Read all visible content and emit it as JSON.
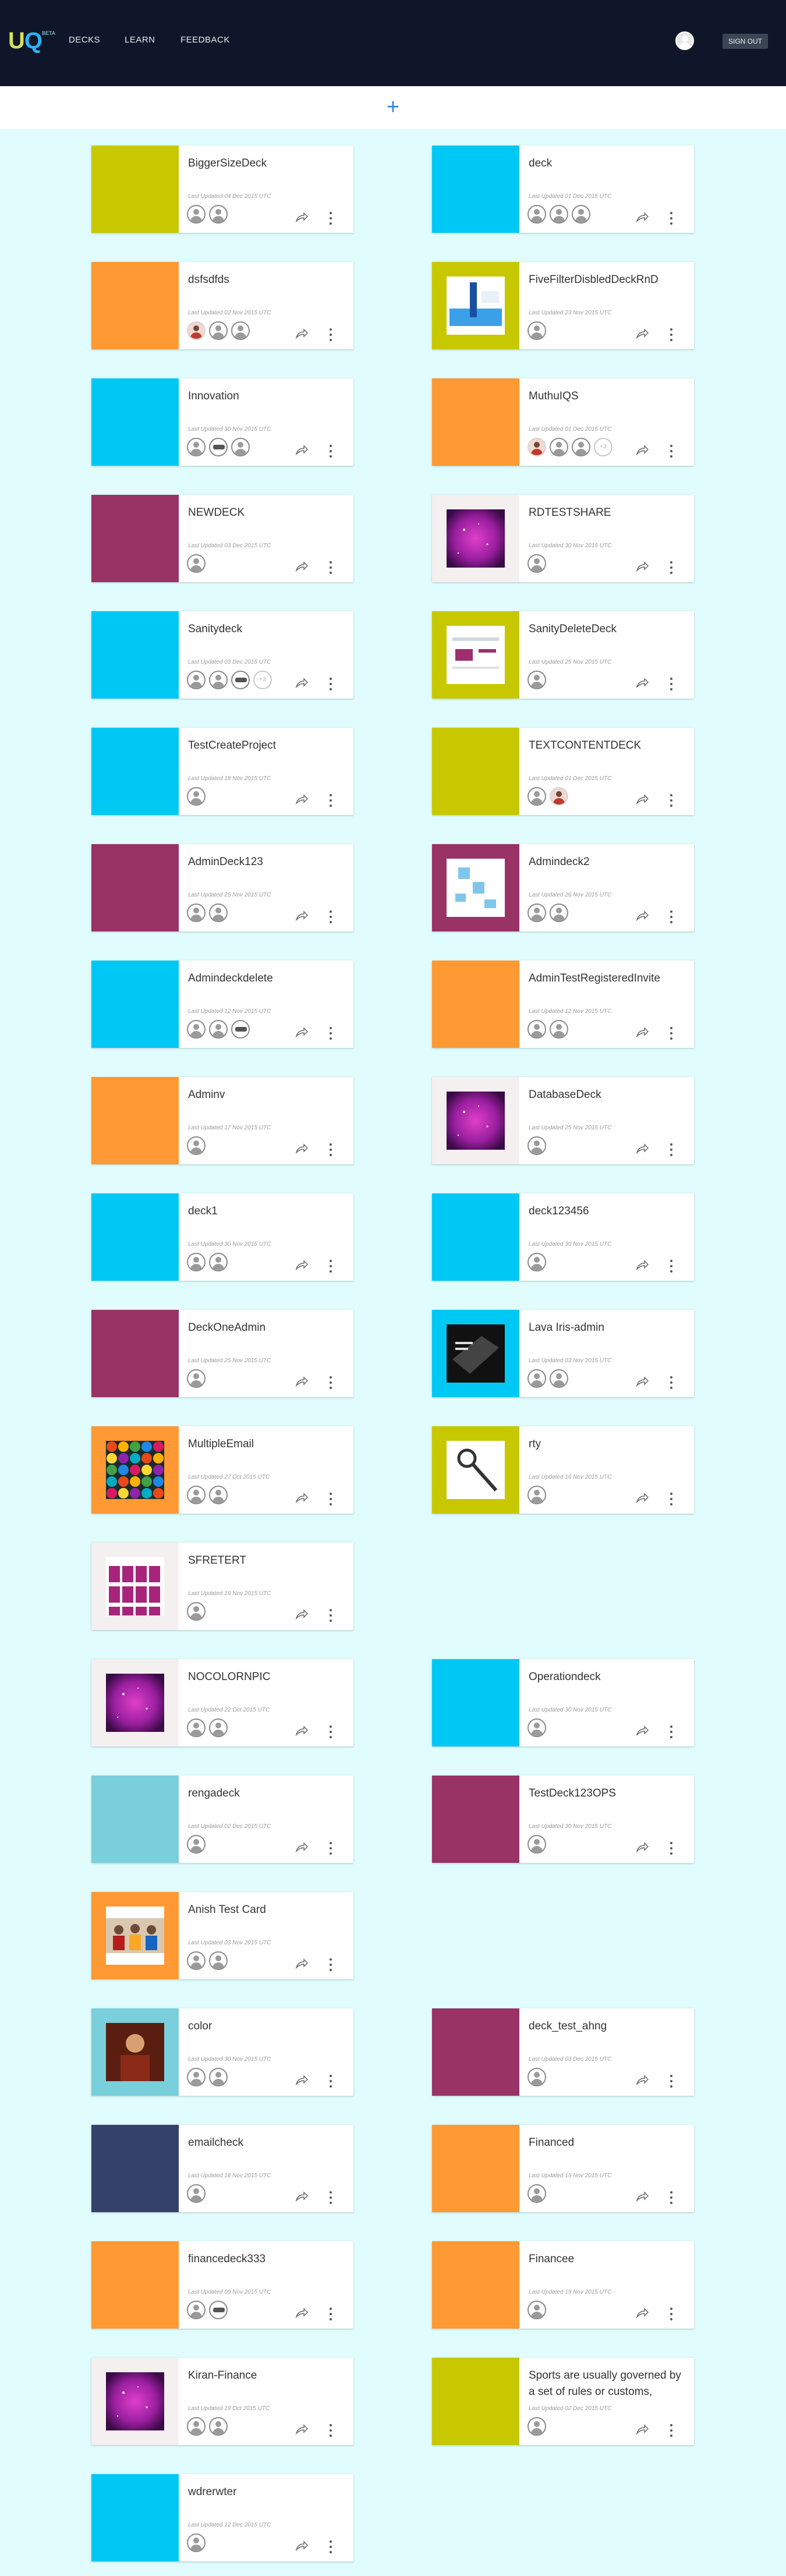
{
  "nav": {
    "logo_u": "U",
    "logo_q": "Q",
    "logo_beta": "BETA",
    "links": [
      "DECKS",
      "LEARN",
      "FEEDBACK"
    ],
    "signout_label": "SIGN OUT"
  },
  "add_button": {
    "label": "+"
  },
  "decks": [
    {
      "title": "BiggerSizeDeck",
      "updated": "Last Updated 04 Dec 2015 UTC",
      "color": "#c8c800",
      "thumb": "",
      "avatars": [
        "p",
        "p"
      ]
    },
    {
      "title": "deck",
      "updated": "Last Updated 01 Dec 2015 UTC",
      "color": "#00c8f5",
      "thumb": "",
      "avatars": [
        "p",
        "p",
        "p"
      ]
    },
    {
      "title": "dsfsdfds",
      "updated": "Last Updated 02 Nov 2015 UTC",
      "color": "#ff9933",
      "thumb": "",
      "avatars": [
        "photo",
        "p",
        "p"
      ]
    },
    {
      "title": "FiveFilterDisbledDeckRnD",
      "updated": "Last Updated 23 Nov 2015 UTC",
      "color": "#c8c800",
      "thumb": "chart",
      "avatars": [
        "p"
      ]
    },
    {
      "title": "Innovation",
      "updated": "Last Updated 30 Nov 2015 UTC",
      "color": "#00c8f5",
      "thumb": "",
      "avatars": [
        "p",
        "logo",
        "p"
      ]
    },
    {
      "title": "MuthuIQS",
      "updated": "Last Updated 01 Dec 2015 UTC",
      "color": "#ff9933",
      "thumb": "",
      "avatars": [
        "photo",
        "p",
        "p",
        "+3"
      ]
    },
    {
      "title": "NEWDECK",
      "updated": "Last Updated 03 Dec 2015 UTC",
      "color": "#993366",
      "thumb": "",
      "avatars": [
        "p"
      ]
    },
    {
      "title": "RDTESTSHARE",
      "updated": "Last Updated 30 Nov 2015 UTC",
      "color": "#f5f0f0",
      "thumb": "galaxy",
      "avatars": [
        "p"
      ]
    },
    {
      "title": "Sanitydeck",
      "updated": "Last Updated 03 Dec 2015 UTC",
      "color": "#00c8f5",
      "thumb": "",
      "avatars": [
        "p",
        "p",
        "logo",
        "+3"
      ]
    },
    {
      "title": "SanityDeleteDeck",
      "updated": "Last Updated 25 Nov 2015 UTC",
      "color": "#c8c800",
      "thumb": "screenshot",
      "avatars": [
        "p"
      ]
    },
    {
      "title": "TestCreateProject",
      "updated": "Last Updated 18 Nov 2015 UTC",
      "color": "#00c8f5",
      "thumb": "",
      "avatars": [
        "p"
      ]
    },
    {
      "title": "TEXTCONTENTDECK",
      "updated": "Last Updated 01 Dec 2015 UTC",
      "color": "#c8c800",
      "thumb": "",
      "avatars": [
        "p",
        "photo"
      ]
    },
    {
      "title": "AdminDeck123",
      "updated": "Last Updated 25 Nov 2015 UTC",
      "color": "#993366",
      "thumb": "",
      "avatars": [
        "p",
        "p"
      ]
    },
    {
      "title": "Admindeck2",
      "updated": "Last Updated 26 Nov 2015 UTC",
      "color": "#993366",
      "thumb": "diagram",
      "avatars": [
        "p",
        "p"
      ]
    },
    {
      "title": "Admindeckdelete",
      "updated": "Last Updated 12 Nov 2015 UTC",
      "color": "#00c8f5",
      "thumb": "",
      "avatars": [
        "p",
        "p",
        "logo"
      ]
    },
    {
      "title": "AdminTestRegisteredInvite",
      "updated": "Last Updated 12 Nov 2015 UTC",
      "color": "#ff9933",
      "thumb": "",
      "avatars": [
        "p",
        "p"
      ]
    },
    {
      "title": "Adminv",
      "updated": "Last Updated 17 Nov 2015 UTC",
      "color": "#ff9933",
      "thumb": "",
      "avatars": [
        "p"
      ]
    },
    {
      "title": "DatabaseDeck",
      "updated": "Last Updated 25 Nov 2015 UTC",
      "color": "#f5f0f0",
      "thumb": "galaxy",
      "avatars": [
        "p"
      ]
    },
    {
      "title": "deck1",
      "updated": "Last Updated 30 Nov 2015 UTC",
      "color": "#00c8f5",
      "thumb": "",
      "avatars": [
        "p",
        "p"
      ]
    },
    {
      "title": "deck123456",
      "updated": "Last Updated 30 Nov 2015 UTC",
      "color": "#00c8f5",
      "thumb": "",
      "avatars": [
        "p"
      ]
    },
    {
      "title": "DeckOneAdmin",
      "updated": "Last Updated 25 Nov 2015 UTC",
      "color": "#993366",
      "thumb": "",
      "avatars": [
        "p"
      ]
    },
    {
      "title": "Lava Iris-admin",
      "updated": "Last Updated 03 Nov 2015 UTC",
      "color": "#00c8f5",
      "thumb": "dark",
      "avatars": [
        "p",
        "p"
      ]
    },
    {
      "title": "MultipleEmail",
      "updated": "Last Updated 27 Oct 2015 UTC",
      "color": "#ff9933",
      "thumb": "balls",
      "avatars": [
        "p",
        "p"
      ]
    },
    {
      "title": "rty",
      "updated": "Last Updated 16 Nov 2015 UTC",
      "color": "#c8c800",
      "thumb": "tool",
      "avatars": [
        "p"
      ]
    },
    {
      "title": "SFRETERT",
      "updated": "Last Updated 19 Nov 2015 UTC",
      "color": "#f5f0f0",
      "thumb": "cards",
      "avatars": [
        "p"
      ]
    },
    {
      "title": "NOCOLORNPIC",
      "updated": "Last Updated 22 Oct 2015 UTC",
      "color": "#f5f0f0",
      "thumb": "galaxy",
      "avatars": [
        "p",
        "p"
      ]
    },
    {
      "title": "Operationdeck",
      "updated": "Last Updated 30 Nov 2015 UTC",
      "color": "#00c8f5",
      "thumb": "",
      "avatars": [
        "p"
      ]
    },
    {
      "title": "rengadeck",
      "updated": "Last Updated 02 Dec 2015 UTC",
      "color": "#7acfdc",
      "thumb": "",
      "avatars": [
        "p"
      ]
    },
    {
      "title": "TestDeck123OPS",
      "updated": "Last Updated 30 Nov 2015 UTC",
      "color": "#993366",
      "thumb": "",
      "avatars": [
        "p"
      ]
    },
    {
      "title": "Anish Test Card",
      "updated": "Last Updated 03 Nov 2015 UTC",
      "color": "#ff9933",
      "thumb": "people",
      "avatars": [
        "p",
        "p"
      ]
    },
    {
      "title": "color",
      "updated": "Last Updated 30 Nov 2015 UTC",
      "color": "#7acfdc",
      "thumb": "portrait",
      "avatars": [
        "p",
        "p"
      ]
    },
    {
      "title": "deck_test_ahng",
      "updated": "Last Updated 03 Dec 2015 UTC",
      "color": "#993366",
      "thumb": "",
      "avatars": [
        "p"
      ]
    },
    {
      "title": "emailcheck",
      "updated": "Last Updated 18 Nov 2015 UTC",
      "color": "#33416b",
      "thumb": "",
      "avatars": [
        "p"
      ]
    },
    {
      "title": "Financed",
      "updated": "Last Updated 19 Nov 2015 UTC",
      "color": "#ff9933",
      "thumb": "",
      "avatars": [
        "p"
      ]
    },
    {
      "title": "financedeck333",
      "updated": "Last Updated 09 Nov 2015 UTC",
      "color": "#ff9933",
      "thumb": "",
      "avatars": [
        "p",
        "logo"
      ]
    },
    {
      "title": "Financee",
      "updated": "Last Updated 19 Nov 2015 UTC",
      "color": "#ff9933",
      "thumb": "",
      "avatars": [
        "p"
      ]
    },
    {
      "title": "Kiran-Finance",
      "updated": "Last Updated 19 Oct 2015 UTC",
      "color": "#f5f0f0",
      "thumb": "galaxy",
      "avatars": [
        "p",
        "p"
      ]
    },
    {
      "title": "Sports are usually governed by a set of rules or customs,",
      "updated": "Last Updated 02 Dec 2015 UTC",
      "color": "#c8c800",
      "thumb": "",
      "avatars": [
        "p"
      ]
    },
    {
      "title": "wdrerwter",
      "updated": "Last Updated 12 Dec 2015 UTC",
      "color": "#00c8f5",
      "thumb": "",
      "avatars": [
        "p"
      ]
    }
  ]
}
